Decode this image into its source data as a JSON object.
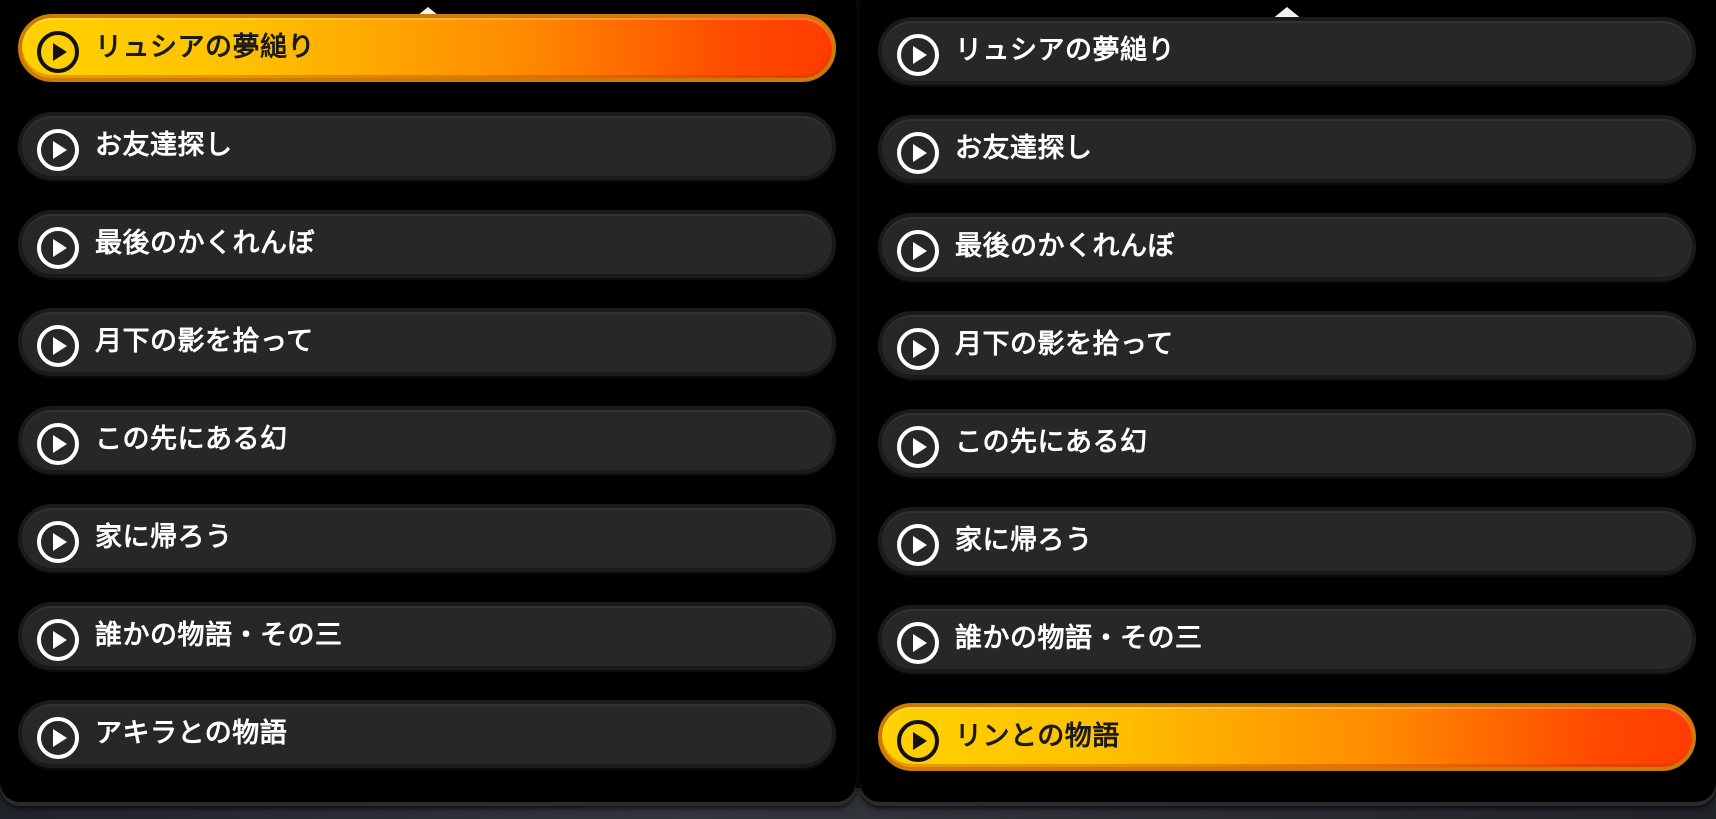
{
  "left_list": {
    "items": [
      {
        "label": "リュシアの夢縋り",
        "selected": true
      },
      {
        "label": "お友達探し",
        "selected": false
      },
      {
        "label": "最後のかくれんぼ",
        "selected": false
      },
      {
        "label": "月下の影を拾って",
        "selected": false
      },
      {
        "label": "この先にある幻",
        "selected": false
      },
      {
        "label": "家に帰ろう",
        "selected": false
      },
      {
        "label": "誰かの物語・その三",
        "selected": false
      },
      {
        "label": "アキラとの物語",
        "selected": false
      }
    ]
  },
  "right_list": {
    "items": [
      {
        "label": "リュシアの夢縋り",
        "selected": false
      },
      {
        "label": "お友達探し",
        "selected": false
      },
      {
        "label": "最後のかくれんぼ",
        "selected": false
      },
      {
        "label": "月下の影を拾って",
        "selected": false
      },
      {
        "label": "この先にある幻",
        "selected": false
      },
      {
        "label": "家に帰ろう",
        "selected": false
      },
      {
        "label": "誰かの物語・その三",
        "selected": false
      },
      {
        "label": "リンとの物語",
        "selected": true
      }
    ]
  },
  "icons": {
    "scroll": "chevron-up-icon",
    "item": "play-circle-icon"
  },
  "colors": {
    "selected_start": "#ffd200",
    "selected_end": "#ff3c00",
    "item_bg": "#272727",
    "panel_bg": "#000000"
  }
}
